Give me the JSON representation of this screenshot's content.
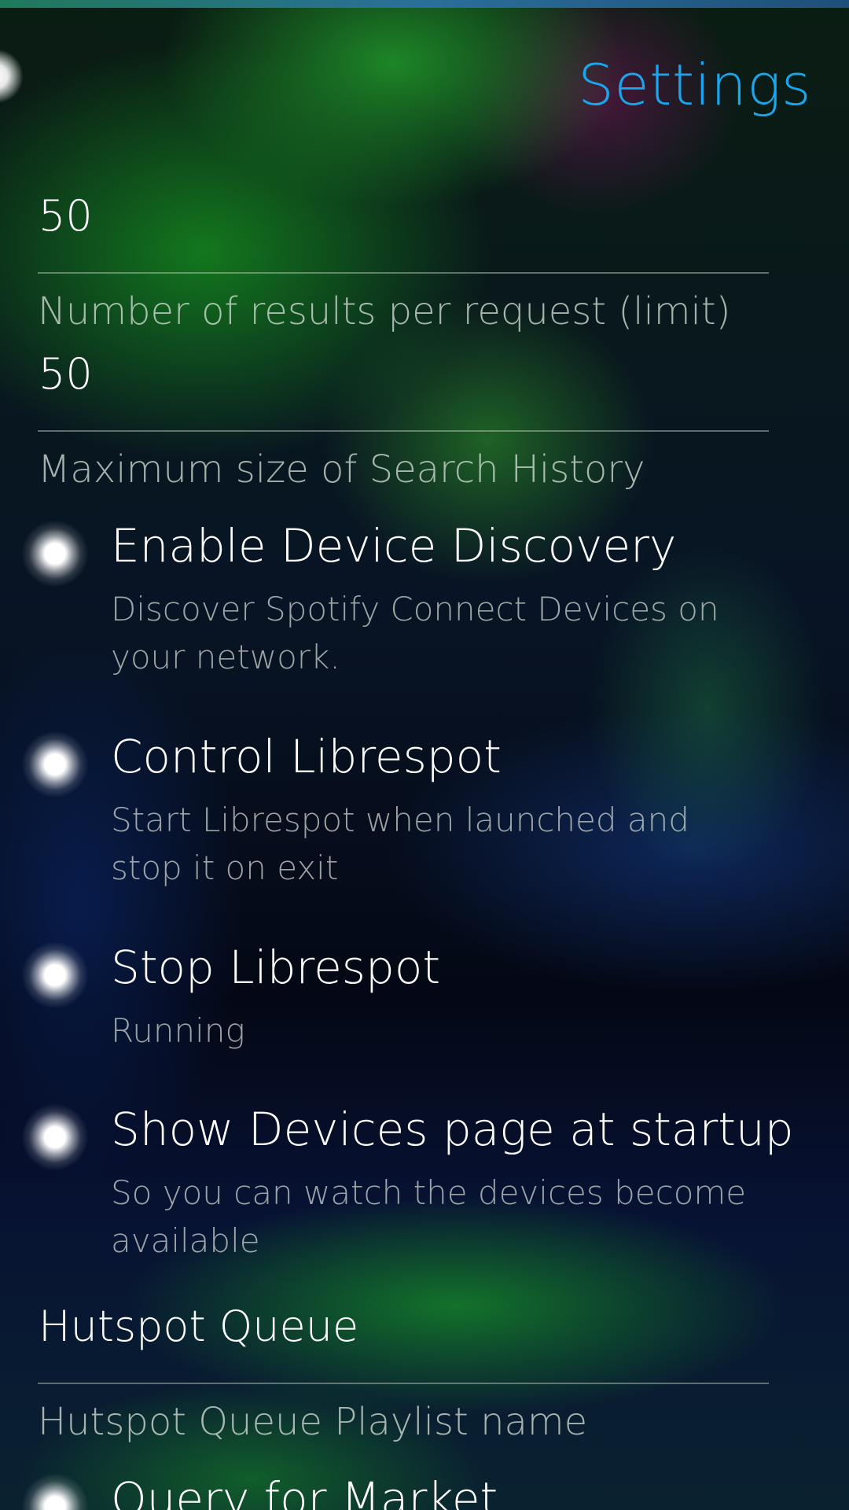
{
  "header": {
    "title": "Settings"
  },
  "fields": [
    {
      "value": "50",
      "label": "Number of results per request (limit)"
    },
    {
      "value": "50",
      "label": "Maximum size of Search History"
    },
    {
      "value": "Hutspot Queue",
      "label": "Hutspot Queue Playlist name"
    }
  ],
  "switches": [
    {
      "title": "Enable Device Discovery",
      "description": "Discover Spotify Connect Devices on your network.",
      "checked": true
    },
    {
      "title": "Control Librespot",
      "description": "Start Librespot when launched and stop it on exit",
      "checked": true
    },
    {
      "title": "Stop Librespot",
      "description": "Running",
      "checked": true
    },
    {
      "title": "Show Devices page at startup",
      "description": "So you can watch the devices become available",
      "checked": true
    },
    {
      "title": "Query for Market",
      "description": "",
      "checked": true
    }
  ],
  "colors": {
    "accent": "#19a6ec",
    "primary_text": "#ffffff",
    "secondary_text": "#d2dcd2"
  }
}
